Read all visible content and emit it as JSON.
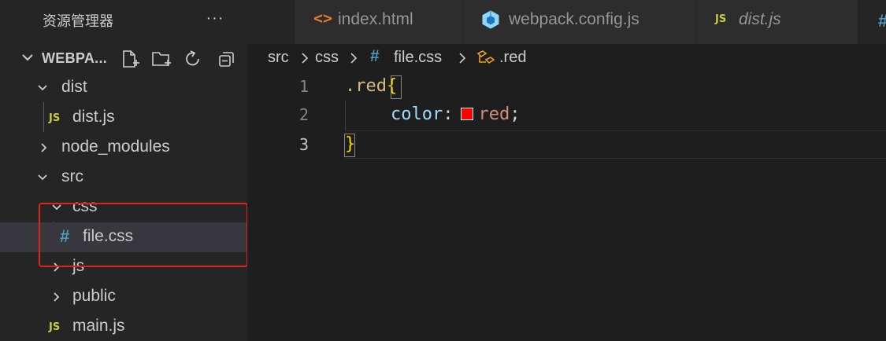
{
  "sidebar": {
    "title": "资源管理器",
    "more": "···",
    "project": {
      "name": "WEBPA..."
    },
    "actions": [
      "new-file-icon",
      "new-folder-icon",
      "refresh-icon",
      "collapse-all-icon"
    ],
    "items": [
      {
        "label": "dist",
        "kind": "folder",
        "expanded": true
      },
      {
        "label": "dist.js",
        "kind": "js-file",
        "badge": "JS"
      },
      {
        "label": "node_modules",
        "kind": "folder",
        "expanded": false
      },
      {
        "label": "src",
        "kind": "folder",
        "expanded": true
      },
      {
        "label": "css",
        "kind": "folder",
        "expanded": true
      },
      {
        "label": "file.css",
        "kind": "css-file",
        "badge": "#",
        "selected": true
      },
      {
        "label": "js",
        "kind": "folder",
        "expanded": false
      },
      {
        "label": "public",
        "kind": "folder",
        "expanded": false
      },
      {
        "label": "main.js",
        "kind": "js-file",
        "badge": "JS"
      }
    ]
  },
  "tabs": [
    {
      "label": "index.html",
      "icon": "html-icon",
      "icon_glyph": "<>"
    },
    {
      "label": "webpack.config.js",
      "icon": "webpack-icon"
    },
    {
      "label": "dist.js",
      "icon": "js-icon",
      "icon_glyph": "JS",
      "italic": true
    }
  ],
  "tab_overflow_glyph": "#",
  "breadcrumbs": {
    "items": [
      "src",
      "css",
      "file.css",
      ".red"
    ],
    "file_glyph": "#"
  },
  "editor": {
    "line_numbers": [
      "1",
      "2",
      "3"
    ],
    "active_line": "3",
    "code": {
      "l1_selector": ".red",
      "l1_brace": "{",
      "l2_prop": "color",
      "l2_colon": ":",
      "l2_value": "red",
      "l2_semi": ";",
      "l3_brace": "}"
    },
    "swatch_color": "#ff0000"
  },
  "colors": {
    "sidebar_bg": "#252526",
    "editor_bg": "#1e1e1e",
    "highlight_border": "#e0221d",
    "js_badge": "#cbcb41",
    "css_badge": "#519aba"
  }
}
